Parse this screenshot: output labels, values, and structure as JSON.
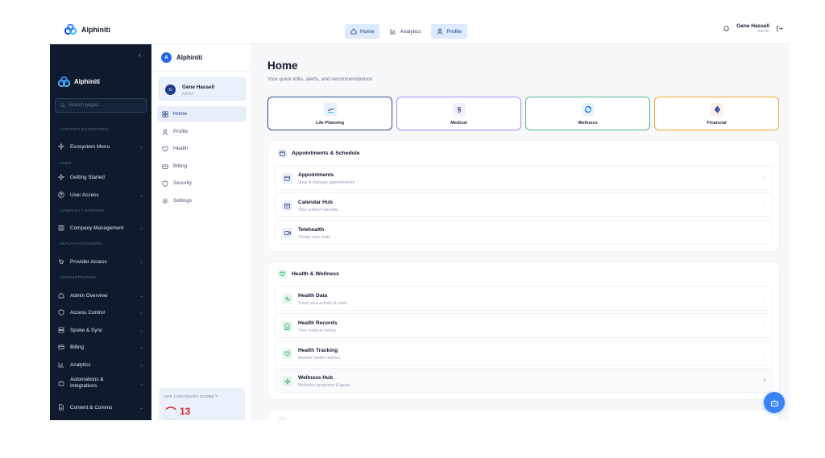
{
  "app": {
    "name": "Alphiniti"
  },
  "topbar": {
    "tabs": [
      {
        "label": "Home",
        "icon": "home-icon",
        "active": true
      },
      {
        "label": "Analytics",
        "icon": "bar-chart-icon",
        "active": false
      },
      {
        "label": "Profile",
        "icon": "user-icon",
        "active": true
      }
    ],
    "user": {
      "name": "Gene Hassell",
      "role": "admin"
    }
  },
  "darkSidebar": {
    "brand": "Alphiniti",
    "search_placeholder": "Search pages...",
    "sections": {
      "ecosystem": "ALPHINITI ECOSYSTEM",
      "user": "USER",
      "company": "COMPANY / PARTNER",
      "health": "HEALTH PROVIDERS",
      "admin": "ADMINISTRATION"
    },
    "items": [
      {
        "label": "Ecosystem Menu"
      },
      {
        "label": "Getting Started"
      },
      {
        "label": "User Access"
      },
      {
        "label": "Company Management"
      },
      {
        "label": "Provider Access"
      },
      {
        "label": "Admin Overview"
      },
      {
        "label": "Access Control"
      },
      {
        "label": "Spoke & Sync"
      },
      {
        "label": "Billing"
      },
      {
        "label": "Analytics"
      },
      {
        "label": "Automations & Integrations"
      },
      {
        "label": "Content & Comms"
      }
    ]
  },
  "lightSidebar": {
    "brand": "Alphiniti",
    "brand_initial": "A",
    "user": {
      "initial": "G",
      "name": "Gene Hassell",
      "role": "Admin"
    },
    "items": [
      {
        "label": "Home",
        "active": true
      },
      {
        "label": "Profile"
      },
      {
        "label": "Health"
      },
      {
        "label": "Billing"
      },
      {
        "label": "Security"
      },
      {
        "label": "Settings"
      }
    ],
    "score": {
      "label": "LIFE CONTINUITY SCORE™",
      "value": "13"
    }
  },
  "main": {
    "title": "Home",
    "subtitle": "Your quick links, alerts, and recommendations",
    "quickLinks": [
      {
        "label": "Life Planning",
        "color": "#2b4c8c",
        "tint": "#e8effa"
      },
      {
        "label": "Medical",
        "color": "#a78bfa",
        "tint": "#f3effe"
      },
      {
        "label": "Wellness",
        "color": "#4fb79b",
        "tint": "#e8f4fb"
      },
      {
        "label": "Financial",
        "color": "#f0a830",
        "tint": "#fdeee6"
      }
    ],
    "appointments": {
      "title": "Appointments & Schedule",
      "items": [
        {
          "title": "Appointments",
          "subtitle": "View & manage appointments"
        },
        {
          "title": "Calendar Hub",
          "subtitle": "Your unified calendar"
        },
        {
          "title": "Telehealth",
          "subtitle": "Virtual care visits"
        }
      ]
    },
    "wellness": {
      "title": "Health & Wellness",
      "items": [
        {
          "title": "Health Data",
          "subtitle": "Track your activity & vitals"
        },
        {
          "title": "Health Records",
          "subtitle": "Your medical history"
        },
        {
          "title": "Health Tracking",
          "subtitle": "Monitor health metrics"
        },
        {
          "title": "Wellness Hub",
          "subtitle": "Wellness programs & goals"
        }
      ]
    }
  },
  "colors": {
    "accent": "#2563eb",
    "darkSidebar": "#0f1b2d",
    "scoreRed": "#dc2626"
  }
}
